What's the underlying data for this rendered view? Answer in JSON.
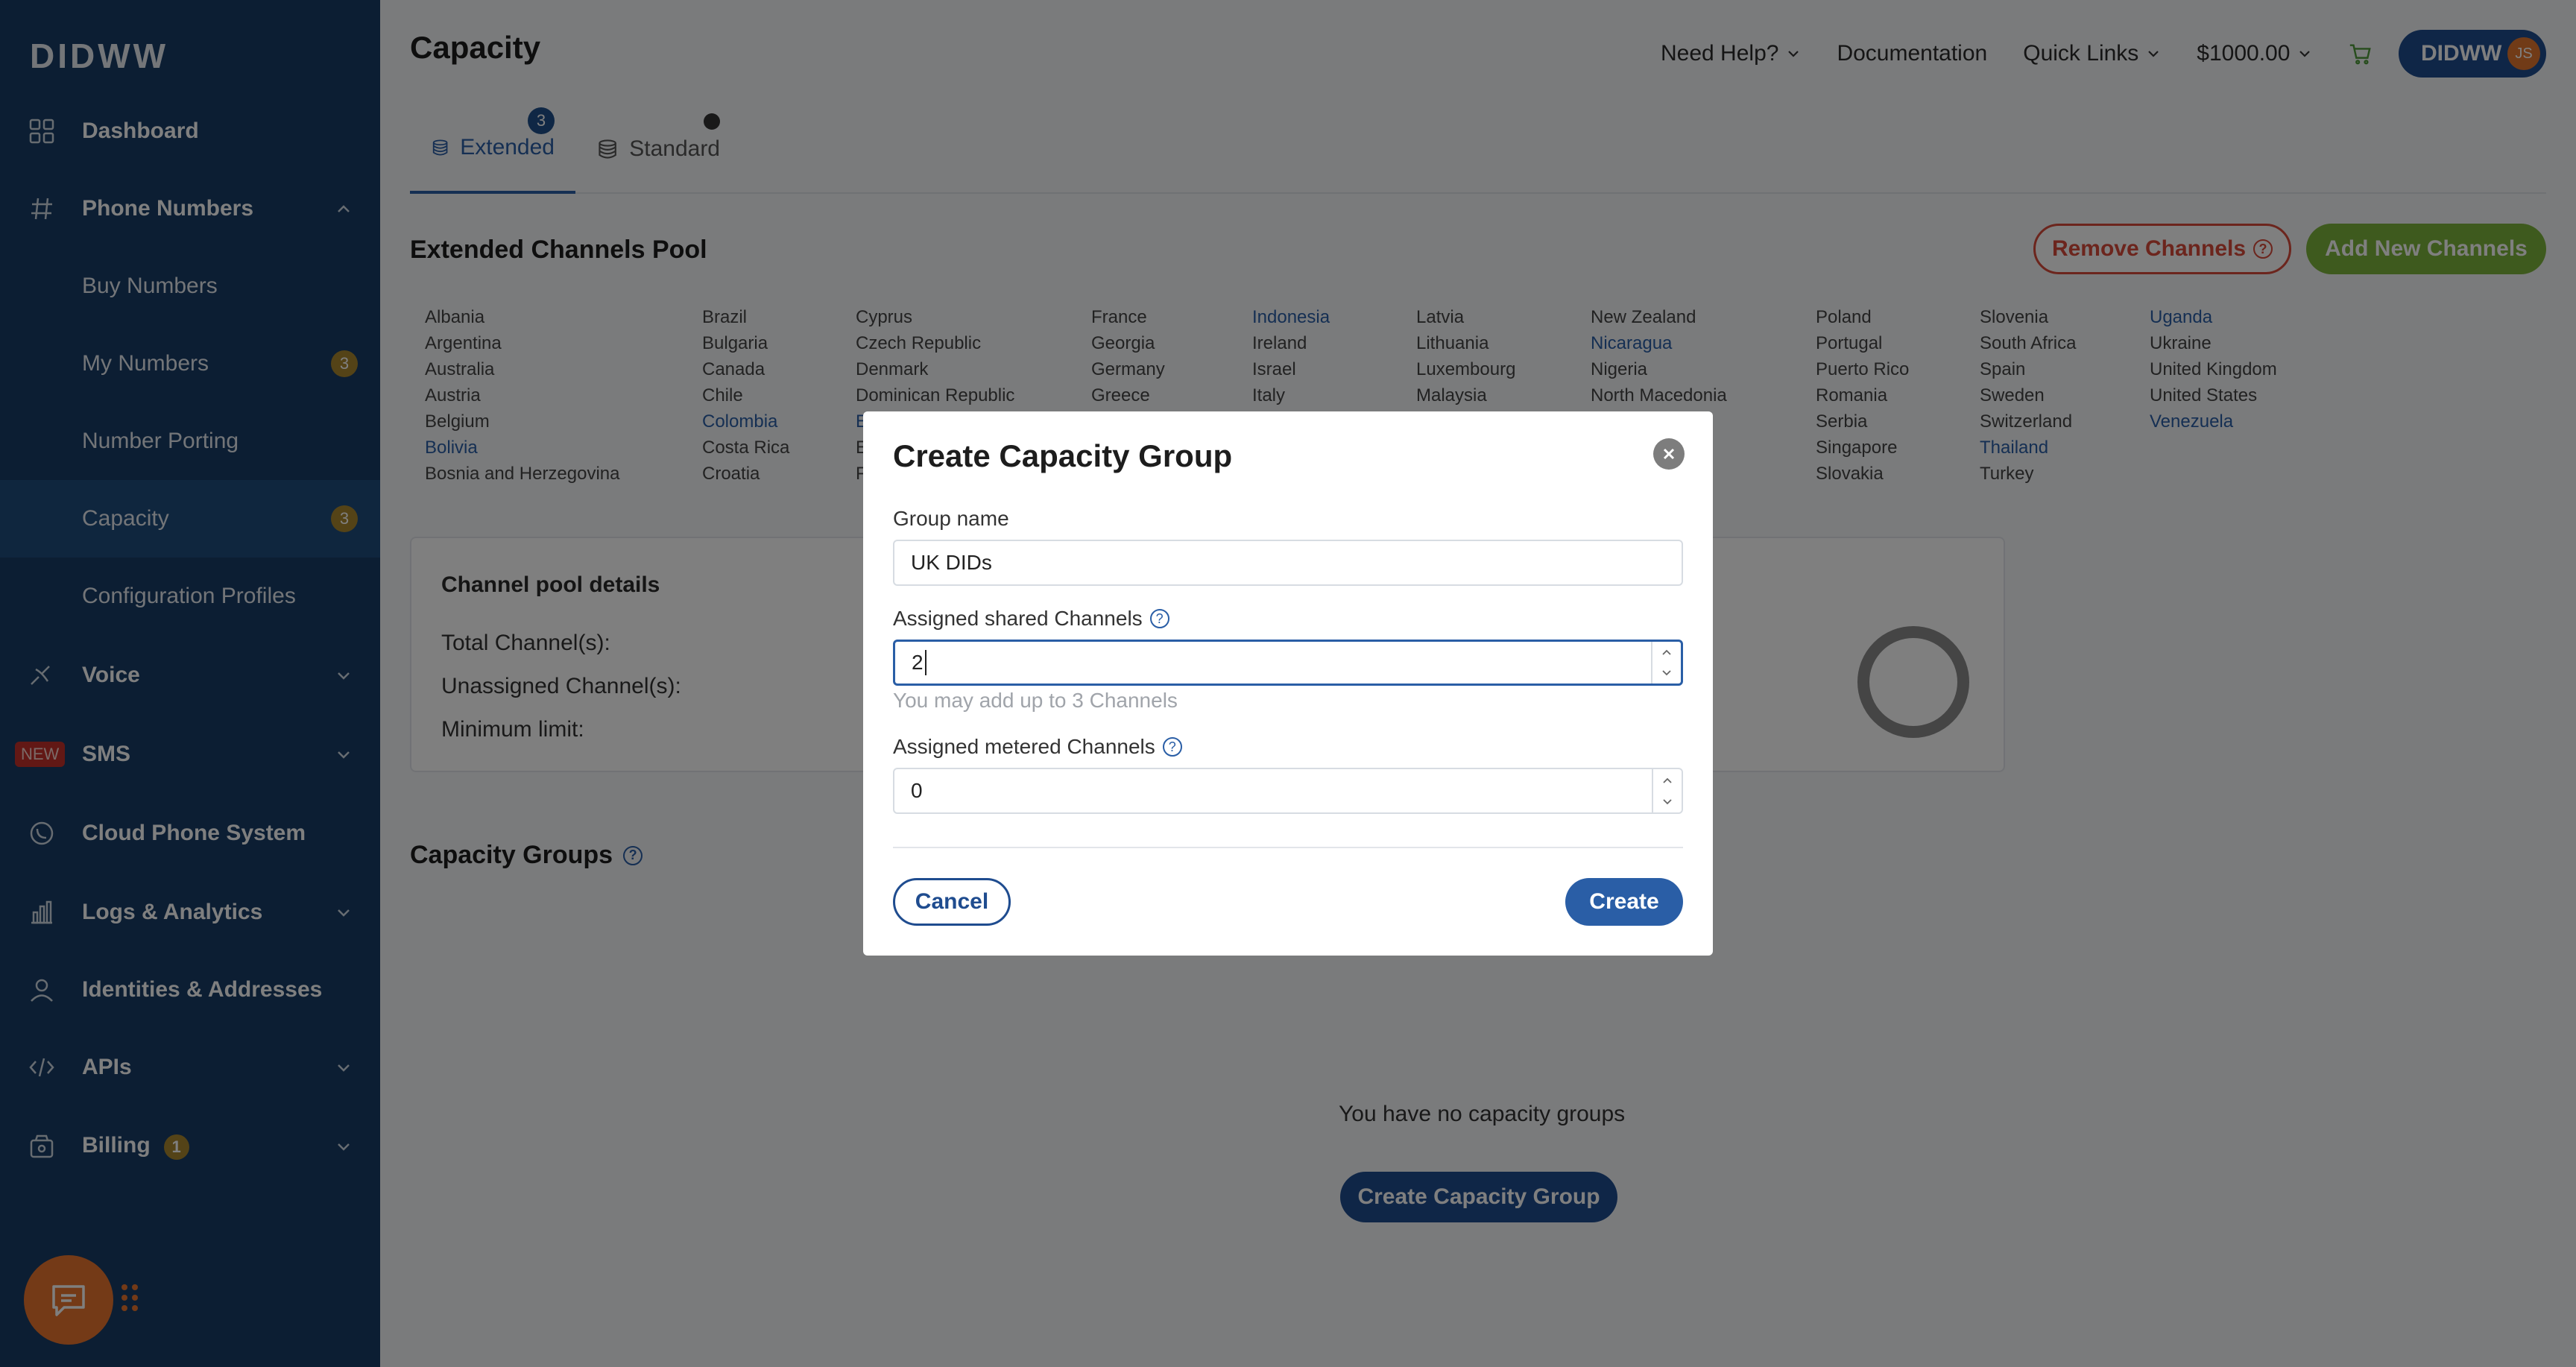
{
  "sidebar": {
    "logo": "DIDWW",
    "items": [
      {
        "label": "Dashboard"
      },
      {
        "label": "Phone Numbers"
      },
      {
        "label": "Buy Numbers"
      },
      {
        "label": "My Numbers",
        "badge": "3"
      },
      {
        "label": "Number Porting"
      },
      {
        "label": "Capacity",
        "badge": "3"
      },
      {
        "label": "Configuration Profiles"
      },
      {
        "label": "Voice"
      },
      {
        "label": "SMS",
        "tag": "NEW"
      },
      {
        "label": "Cloud Phone System"
      },
      {
        "label": "Logs & Analytics"
      },
      {
        "label": "Identities & Addresses"
      },
      {
        "label": "APIs"
      },
      {
        "label": "Billing",
        "badge": "1"
      }
    ]
  },
  "header": {
    "title": "Capacity",
    "need_help": "Need Help?",
    "documentation": "Documentation",
    "quick_links": "Quick Links",
    "balance": "$1000.00",
    "account": "DIDWW",
    "avatar_initials": "JS"
  },
  "tabs": [
    {
      "label": "Extended",
      "badge": "3"
    },
    {
      "label": "Standard"
    }
  ],
  "pool": {
    "title": "Extended Channels Pool",
    "remove_label": "Remove Channels",
    "add_label": "Add New Channels",
    "countries": [
      [
        "Albania",
        "Argentina",
        "Australia",
        "Austria",
        "Belgium",
        "Bolivia",
        "Bosnia and Herzegovina"
      ],
      [
        "Brazil",
        "Bulgaria",
        "Canada",
        "Chile",
        "Colombia",
        "Costa Rica",
        "Croatia"
      ],
      [
        "Cyprus",
        "Czech Republic",
        "Denmark",
        "Dominican Republic",
        "Ec",
        "Es",
        "Fi"
      ],
      [
        "France",
        "Georgia",
        "Germany",
        "Greece"
      ],
      [
        "Indonesia",
        "Ireland",
        "Israel",
        "Italy"
      ],
      [
        "Latvia",
        "Lithuania",
        "Luxembourg",
        "Malaysia"
      ],
      [
        "New Zealand",
        "Nicaragua",
        "Nigeria",
        "North Macedonia"
      ],
      [
        "Poland",
        "Portugal",
        "Puerto Rico",
        "Romania",
        "Serbia",
        "Singapore",
        "Slovakia"
      ],
      [
        "Slovenia",
        "South Africa",
        "Spain",
        "Sweden",
        "Switzerland",
        "Thailand",
        "Turkey"
      ],
      [
        "Uganda",
        "Ukraine",
        "United Kingdom",
        "United States",
        "Venezuela"
      ]
    ],
    "links": [
      "Bolivia",
      "Colombia",
      "Ec",
      "Indonesia",
      "Nicaragua",
      "Thailand",
      "Uganda",
      "Venezuela"
    ]
  },
  "details": {
    "title": "Channel pool details",
    "total": "Total Channel(s):",
    "unassigned": "Unassigned Channel(s):",
    "minimum": "Minimum limit:"
  },
  "groups": {
    "title": "Capacity Groups",
    "empty": "You have no capacity groups",
    "create_label": "Create Capacity Group"
  },
  "modal": {
    "title": "Create Capacity Group",
    "group_name_label": "Group name",
    "group_name_value": "UK DIDs",
    "shared_label": "Assigned shared Channels",
    "shared_value": "2",
    "shared_hint": "You may add up to 3 Channels",
    "metered_label": "Assigned metered Channels",
    "metered_value": "0",
    "cancel": "Cancel",
    "create": "Create"
  },
  "colors": {
    "sidebar": "#183d67",
    "primary": "#2a5ea6",
    "danger": "#d84a3a",
    "success": "#7db43c",
    "accent": "#e8742f"
  }
}
